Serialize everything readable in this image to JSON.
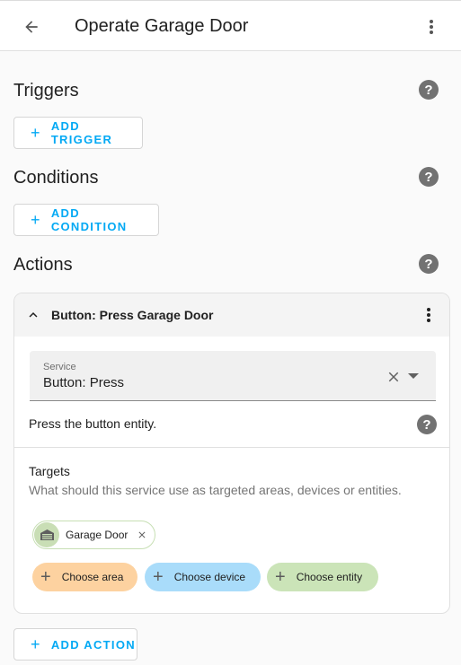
{
  "header": {
    "title": "Operate Garage Door",
    "back_icon": "arrow-left-icon",
    "menu_icon": "dots-vertical-icon"
  },
  "triggers": {
    "heading": "Triggers",
    "add_label": "ADD TRIGGER"
  },
  "conditions": {
    "heading": "Conditions",
    "add_label": "ADD CONDITION"
  },
  "actions": {
    "heading": "Actions",
    "add_label": "ADD ACTION",
    "card": {
      "title": "Button: Press Garage Door",
      "service_field": {
        "label": "Service",
        "value": "Button: Press"
      },
      "description": "Press the button entity.",
      "targets": {
        "label": "Targets",
        "description": "What should this service use as targeted areas, devices or entities.",
        "selected": [
          {
            "label": "Garage Door",
            "icon": "garage-icon"
          }
        ],
        "add_area": "Choose area",
        "add_device": "Choose device",
        "add_entity": "Choose entity"
      }
    }
  },
  "colors": {
    "accent": "#03a9f4",
    "area_chip": "#fdd2a0",
    "device_chip": "#a9dcfa",
    "entity_chip": "#cbe4b8",
    "help_icon": "#727272"
  },
  "help_symbol": "?",
  "plus_symbol": "+"
}
